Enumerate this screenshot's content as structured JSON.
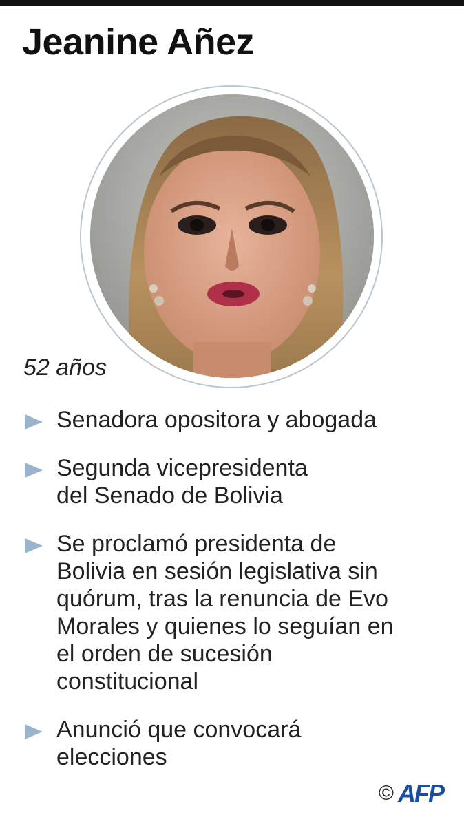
{
  "header": {
    "title": "Jeanine Añez"
  },
  "portrait": {
    "alt": "Retrato de Jeanine Añez"
  },
  "age": "52 años",
  "facts": [
    {
      "text": "Senadora opositora y abogada"
    },
    {
      "text": "Segunda vicepresidenta\ndel Senado de Bolivia"
    },
    {
      "text": "Se proclamó presidenta de\nBolivia en sesión legislativa sin\nquórum, tras la renuncia de Evo\nMorales y quienes lo seguían en\nel orden de sucesión\nconstitucional"
    },
    {
      "text": "Anunció que convocará\nelecciones"
    }
  ],
  "credit": {
    "copyright": "©",
    "agency": "AFP"
  },
  "colors": {
    "bullet": "#9ab4cc",
    "ring": "#b9c6cf",
    "agency": "#1a4fa0",
    "top_bar": "#111111"
  }
}
